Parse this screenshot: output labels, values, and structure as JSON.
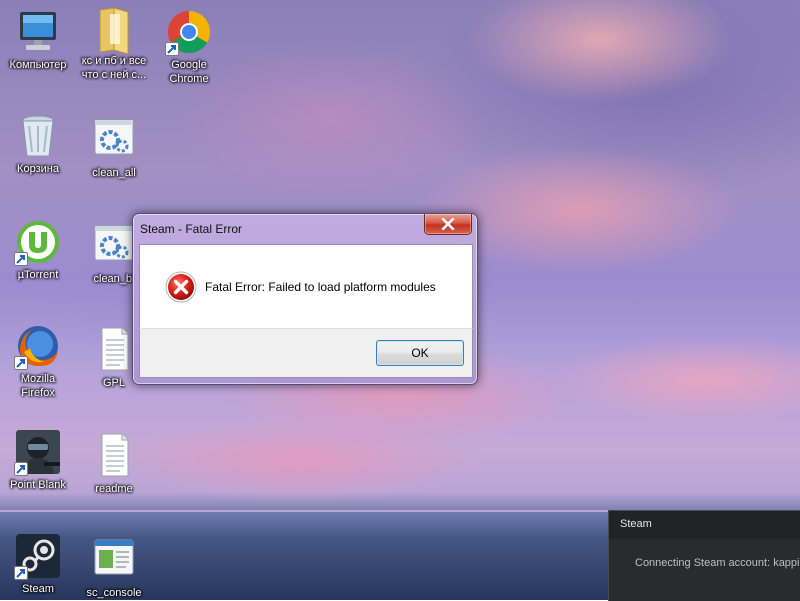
{
  "desktop": {
    "icons": [
      {
        "label": "Компьютер"
      },
      {
        "label": "кс и пб и все\nчто с ней с..."
      },
      {
        "label": "Google\nChrome"
      },
      {
        "label": "Корзина"
      },
      {
        "label": "clean_all"
      },
      {
        "label": "µTorrent"
      },
      {
        "label": "clean_bl"
      },
      {
        "label": "Mozilla\nFirefox"
      },
      {
        "label": "GPL"
      },
      {
        "label": "Point Blank"
      },
      {
        "label": "readme"
      },
      {
        "label": "Steam"
      },
      {
        "label": "sc_console"
      }
    ]
  },
  "dialog": {
    "title": "Steam - Fatal Error",
    "message": "Fatal Error: Failed to load platform modules",
    "ok_label": "OK",
    "icon": "error-icon"
  },
  "steam_panel": {
    "title": "Steam",
    "status": "Connecting Steam account: kappi"
  },
  "colors": {
    "close_button": "#c7402e",
    "ok_border": "#3c7fb1",
    "steam_panel_bg": "#2a2b2f"
  }
}
